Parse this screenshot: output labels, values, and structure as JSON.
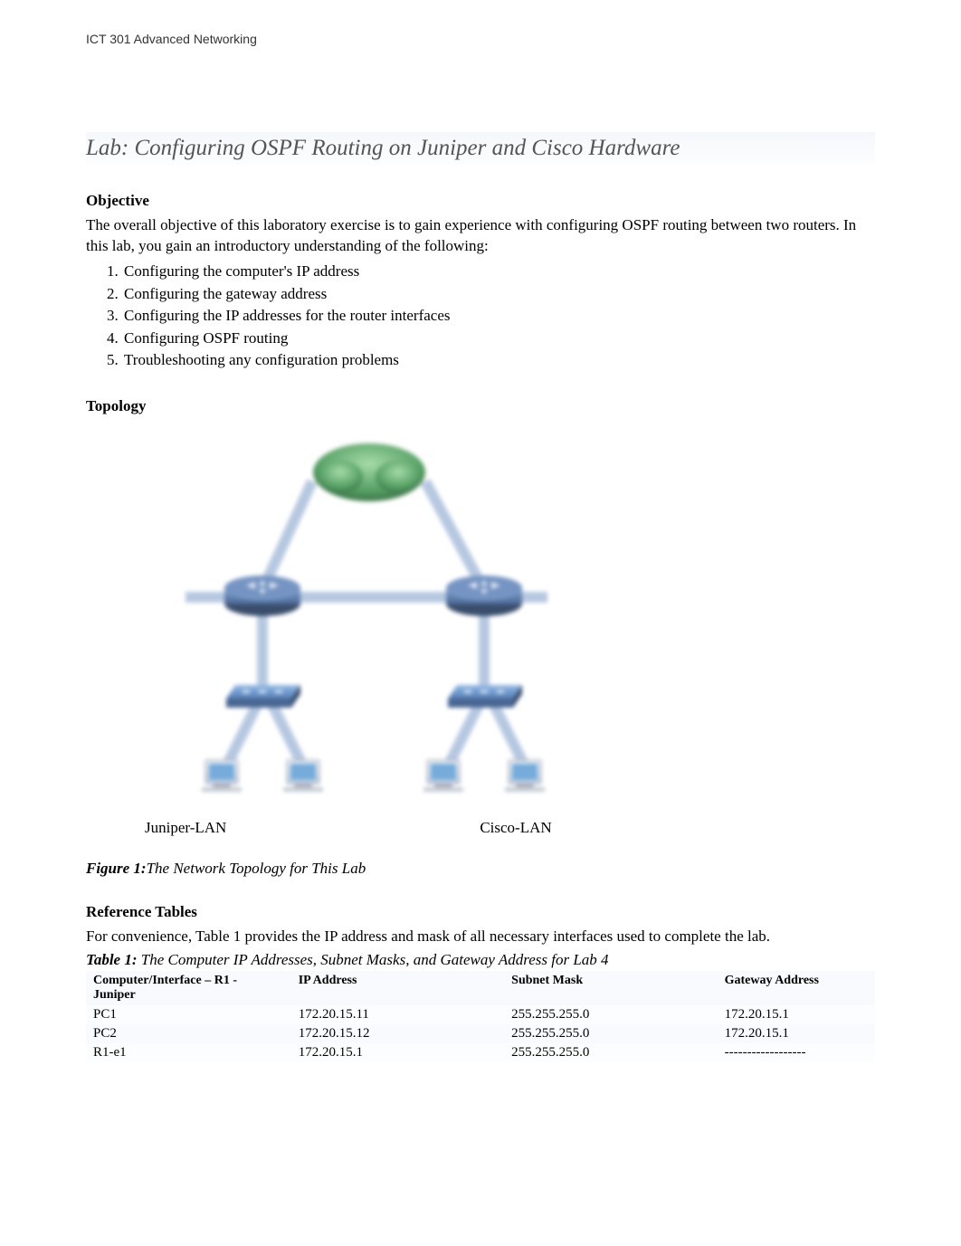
{
  "header": "ICT 301 Advanced Networking",
  "lab_title": "Lab: Configuring OSPF Routing on Juniper and Cisco Hardware",
  "objective": {
    "heading": "Objective",
    "intro_a": "The overall objective of this laboratory exercise ",
    "intro_b": "is to gain experience with configuring OSPF routing between two routers. In this lab, you gain an introductory understanding of the following:",
    "items": [
      "Configuring the computer's IP address",
      "Configuring the gateway address",
      "Configuring the IP addresses for the router interfaces",
      "Configuring OSPF routing",
      "Troubleshooting any configuration problems"
    ]
  },
  "topology": {
    "heading": "Topology",
    "label_left": "Juniper-LAN",
    "label_right": "Cisco-LAN"
  },
  "figure_caption": {
    "bold": "Figure 1:",
    "italic": "The Network Topology for This Lab"
  },
  "reference": {
    "heading": "Reference Tables",
    "intro": "For convenience, Table 1 provides the IP address and mask of all necessary interfaces used to complete the lab."
  },
  "table_caption": {
    "bold": "Table 1:",
    "italic": " The Computer IP Addresses, Subnet Masks, and Gateway Address for Lab 4"
  },
  "table": {
    "headers": {
      "c1a": "Computer/Interface – R1 -",
      "c1b": "Juniper",
      "c2": "IP Address",
      "c3": "Subnet Mask",
      "c4": "Gateway Address"
    },
    "rows": [
      {
        "c1": "PC1",
        "c2": "172.20.15.11",
        "c3": "255.255.255.0",
        "c4": "172.20.15.1"
      },
      {
        "c1": "PC2",
        "c2": "172.20.15.12",
        "c3": "255.255.255.0",
        "c4": "172.20.15.1"
      },
      {
        "c1": "R1-e1",
        "c2": "172.20.15.1",
        "c3": "255.255.255.0",
        "c4": "------------------"
      }
    ]
  }
}
